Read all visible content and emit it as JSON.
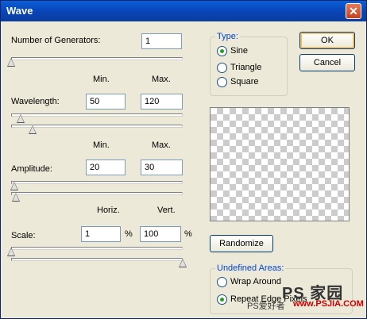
{
  "window": {
    "title": "Wave",
    "close_symbol": "✕"
  },
  "generators": {
    "label": "Number of Generators:",
    "value": "1",
    "level": 0
  },
  "col_headers_1": {
    "left": "Min.",
    "right": "Max."
  },
  "wavelength": {
    "label": "Wavelength:",
    "min": "50",
    "max": "120",
    "min_level": 0.05,
    "max_level": 0.12
  },
  "col_headers_2": {
    "left": "Min.",
    "right": "Max."
  },
  "amplitude": {
    "label": "Amplitude:",
    "min": "20",
    "max": "30",
    "min_level": 0.01,
    "max_level": 0.02
  },
  "col_headers_3": {
    "left": "Horiz.",
    "right": "Vert."
  },
  "scale": {
    "label": "Scale:",
    "horiz": "1",
    "vert": "100",
    "horiz_unit": "%",
    "vert_unit": "%",
    "horiz_level": 0.0,
    "vert_level": 1.0
  },
  "type_group": {
    "title": "Type:",
    "options": [
      {
        "label": "Sine",
        "selected": true
      },
      {
        "label": "Triangle",
        "selected": false
      },
      {
        "label": "Square",
        "selected": false
      }
    ]
  },
  "buttons": {
    "ok": "OK",
    "cancel": "Cancel",
    "randomize": "Randomize"
  },
  "undefined_areas": {
    "title": "Undefined Areas:",
    "options": [
      {
        "label": "Wrap Around",
        "selected": false
      },
      {
        "label": "Repeat Edge Pixels",
        "selected": true
      }
    ]
  },
  "watermark": {
    "line1": "PS 家园",
    "line2": "PS爱好者",
    "line3": "www.PSJIA.COM"
  },
  "colors": {
    "title_bar": "#0a4fc8",
    "dialog_bg": "#ece9d8",
    "group_title": "#0046d5",
    "radio_dot": "#21a121"
  }
}
